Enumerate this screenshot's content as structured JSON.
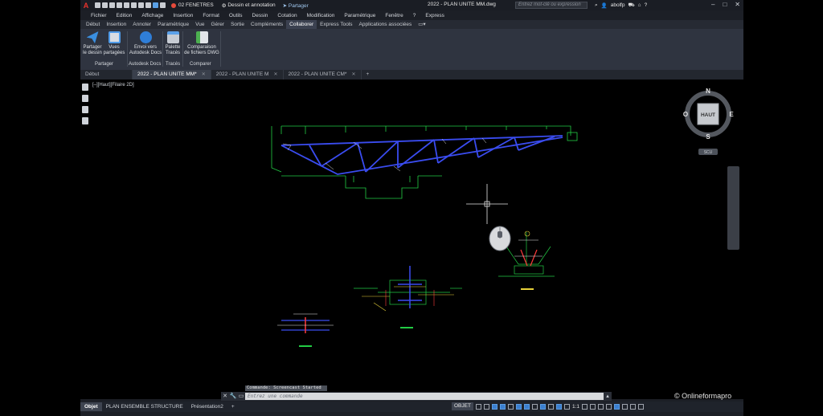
{
  "title_bar": {
    "workspace_layer": "02 FENETRES",
    "workspace": "Dessin et annotation",
    "share": "Partager",
    "document_title": "2022 - PLAN UNITE MM.dwg",
    "search_placeholder": "Entrez mot-clé ou expression",
    "user": "abolfp"
  },
  "menu": [
    "Fichier",
    "Edition",
    "Affichage",
    "Insertion",
    "Format",
    "Outils",
    "Dessin",
    "Cotation",
    "Modification",
    "Paramétrique",
    "Fenêtre",
    "?",
    "Express"
  ],
  "ribbon_tabs": [
    "Début",
    "Insertion",
    "Annoter",
    "Paramétrique",
    "Vue",
    "Gérer",
    "Sortie",
    "Compléments",
    "Collaborer",
    "Express Tools",
    "Applications associées"
  ],
  "active_ribbon_tab": "Collaborer",
  "ribbon": {
    "share_drawing": "Partager le dessin",
    "shared_views": "Vues partagées",
    "send_docs": "Envoi vers Autodesk Docs",
    "palette": "Palette Tracés",
    "compare": "Comparaison de fichiers DWG",
    "group_share": "Partager",
    "group_docs": "Autodesk Docs",
    "group_traces": "Tracés",
    "group_compare": "Comparer"
  },
  "doc_tabs": {
    "start": "Début",
    "tab1": "2022 - PLAN UNITE MM*",
    "tab2": "2022 - PLAN UNITE M",
    "tab3": "2022 - PLAN UNITE CM*"
  },
  "view_label": "[–][Haut][Filaire 2D]",
  "viewcube": {
    "n": "N",
    "s": "S",
    "e": "E",
    "o": "O",
    "face": "HAUT",
    "ucs": "SCU"
  },
  "command": {
    "history": "Commande: Screencast Started",
    "placeholder": "Entrez une commande"
  },
  "watermark": "© Onlineformapro",
  "layout_tabs": [
    "Objet",
    "PLAN ENSEMBLE STRUCTURE",
    "Présentation2"
  ],
  "status": {
    "model": "OBJET",
    "scale": "1:1"
  },
  "colors": {
    "accent": "#3a7fd0",
    "truss": "#3a4cf0",
    "geometry": "#22cc44",
    "annotation": "#e8d23a",
    "dims": "#ff3b3b"
  }
}
